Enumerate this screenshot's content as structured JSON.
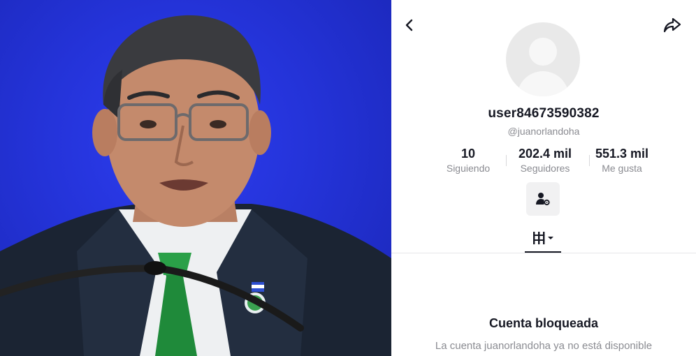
{
  "profile": {
    "username": "user84673590382",
    "handle": "@juanorlandoha",
    "stats": [
      {
        "value": "10",
        "label": "Siguiendo"
      },
      {
        "value": "202.4 mil",
        "label": "Seguidores"
      },
      {
        "value": "551.3 mil",
        "label": "Me gusta"
      }
    ],
    "blocked_title": "Cuenta bloqueada",
    "blocked_description": "La cuenta juanorlandoha ya no está disponible"
  },
  "icons": {
    "back": "chevron-left-icon",
    "share": "share-arrow-icon",
    "add_friend": "person-settings-icon",
    "videos_tab": "videos-grid-icon"
  },
  "colors": {
    "text_primary": "#161823",
    "text_secondary": "#8a8b91",
    "photo_background": "#2433d8",
    "tie": "#1f8a3a"
  }
}
